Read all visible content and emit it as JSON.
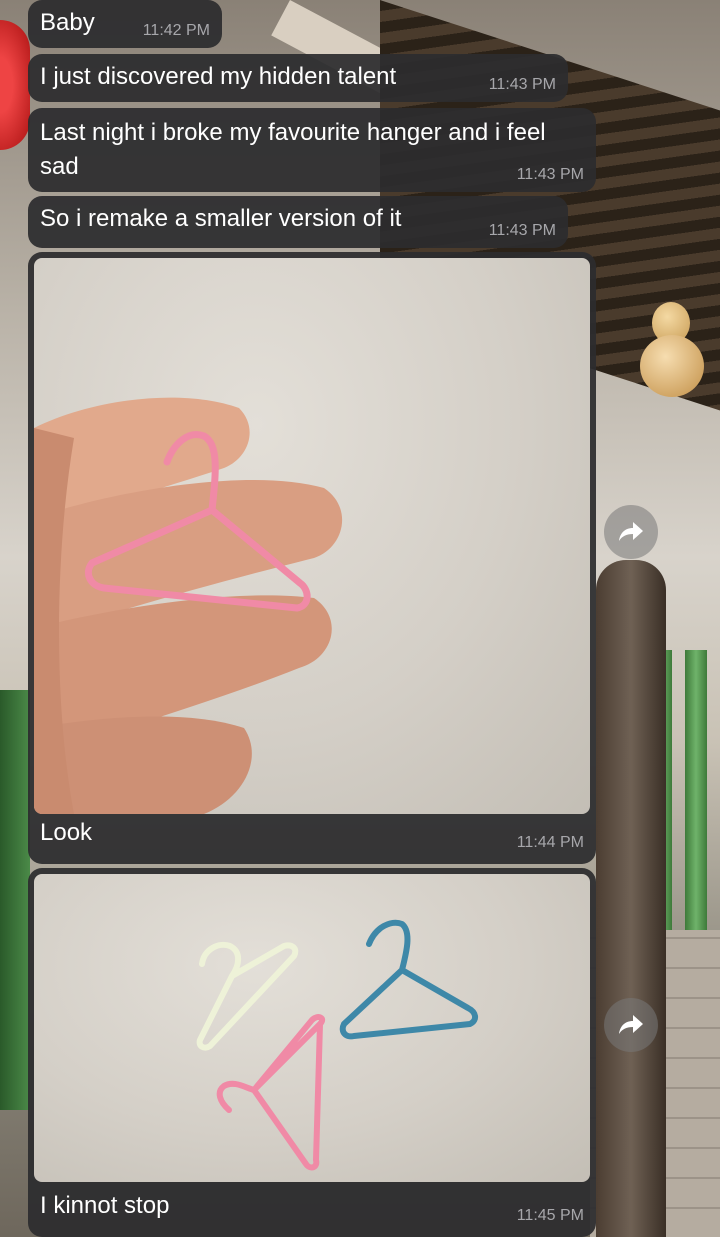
{
  "messages": [
    {
      "text": "Baby",
      "time": "11:42 PM"
    },
    {
      "text": "I just discovered my hidden talent",
      "time": "11:43 PM"
    },
    {
      "text": "Last night i broke my favourite hanger and i feel sad",
      "time": "11:43 PM"
    },
    {
      "text": "So i remake a smaller version of it",
      "time": "11:43 PM"
    },
    {
      "caption": "Look",
      "time": "11:44 PM",
      "photo": "pink-mini-hanger-on-fingers"
    },
    {
      "caption": "I kinnot stop",
      "time": "11:45 PM",
      "photo": "three-mini-hangers-white-pink-blue"
    }
  ],
  "icons": {
    "forward": "share-forward-icon"
  },
  "colors": {
    "bubble": "#2c2c2e",
    "timestamp": "#a7a7ab",
    "hanger_pink": "#f08aa6",
    "hanger_blue": "#3e88a8",
    "hanger_white": "#eef2d8"
  }
}
